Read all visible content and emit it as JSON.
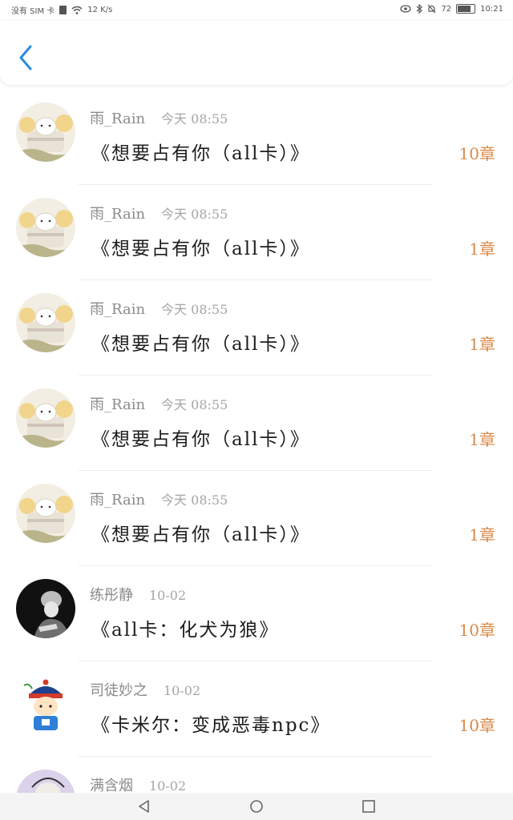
{
  "status_bar": {
    "carrier": "没有 SIM 卡",
    "speed": "12 K/s",
    "battery_pct": "72",
    "time": "10:21"
  },
  "rows": [
    {
      "name": "雨_Rain",
      "time": "今天 08:55",
      "title": "《想要占有你（all卡）》",
      "count": "10章",
      "avatar": "cake-bunny"
    },
    {
      "name": "雨_Rain",
      "time": "今天 08:55",
      "title": "《想要占有你（all卡）》",
      "count": "1章",
      "avatar": "cake-bunny"
    },
    {
      "name": "雨_Rain",
      "time": "今天 08:55",
      "title": "《想要占有你（all卡）》",
      "count": "1章",
      "avatar": "cake-bunny"
    },
    {
      "name": "雨_Rain",
      "time": "今天 08:55",
      "title": "《想要占有你（all卡）》",
      "count": "1章",
      "avatar": "cake-bunny"
    },
    {
      "name": "雨_Rain",
      "time": "今天 08:55",
      "title": "《想要占有你（all卡）》",
      "count": "1章",
      "avatar": "cake-bunny"
    },
    {
      "name": "练彤静",
      "time": "10-02",
      "title": "《all卡：化犬为狼》",
      "count": "10章",
      "avatar": "dark-portrait"
    },
    {
      "name": "司徒妙之",
      "time": "10-02",
      "title": "《卡米尔：变成恶毒npc》",
      "count": "10章",
      "avatar": "cartoon-official"
    },
    {
      "name": "满含烟",
      "time": "10-02",
      "title": "",
      "count": "",
      "avatar": "purple-portrait"
    }
  ]
}
